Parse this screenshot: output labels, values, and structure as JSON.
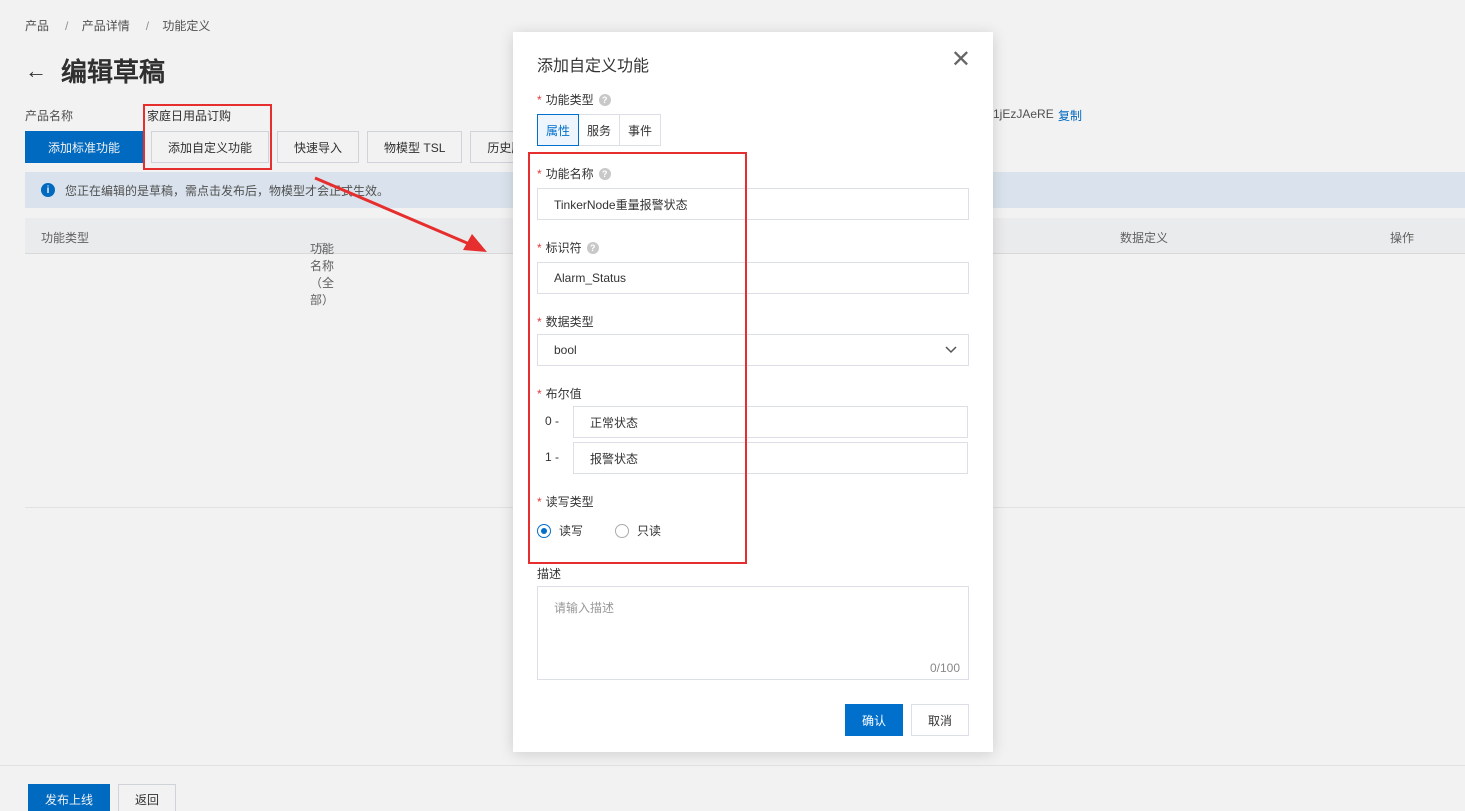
{
  "breadcrumb": [
    "产品",
    "产品详情",
    "功能定义"
  ],
  "page": {
    "title": "编辑草稿",
    "product_label": "产品名称",
    "product_value": "家庭日用品订购",
    "productkey_partial": "1jEzJAeRE",
    "copy_label": "复制"
  },
  "toolbar": {
    "add_standard": "添加标准功能",
    "add_custom": "添加自定义功能",
    "quick_import": "快速导入",
    "tsl": "物模型 TSL",
    "history": "历史版"
  },
  "notice": {
    "icon": "info-icon",
    "text": "您正在编辑的是草稿，需点击发布后，物模型才会正式生效。"
  },
  "table": {
    "headers": [
      "功能类型",
      "功能名称（全部）",
      "数据定义",
      "操作"
    ]
  },
  "footer": {
    "publish": "发布上线",
    "back": "返回"
  },
  "modal": {
    "title": "添加自定义功能",
    "feature_type_label": "功能类型",
    "feature_types": [
      "属性",
      "服务",
      "事件"
    ],
    "feature_type_selected": "属性",
    "name_label": "功能名称",
    "name_value": "TinkerNode重量报警状态",
    "identifier_label": "标识符",
    "identifier_value": "Alarm_Status",
    "datatype_label": "数据类型",
    "datatype_value": "bool",
    "bool_label": "布尔值",
    "bool_0_prefix": "0 -",
    "bool_0_value": "正常状态",
    "bool_1_prefix": "1 -",
    "bool_1_value": "报警状态",
    "rw_label": "读写类型",
    "rw_options": [
      "读写",
      "只读"
    ],
    "rw_selected": "读写",
    "desc_label": "描述",
    "desc_placeholder": "请输入描述",
    "desc_counter": "0/100",
    "confirm": "确认",
    "cancel": "取消"
  },
  "colors": {
    "primary": "#0070cc",
    "annotation": "#e62e2e",
    "required": "#e4393c"
  }
}
